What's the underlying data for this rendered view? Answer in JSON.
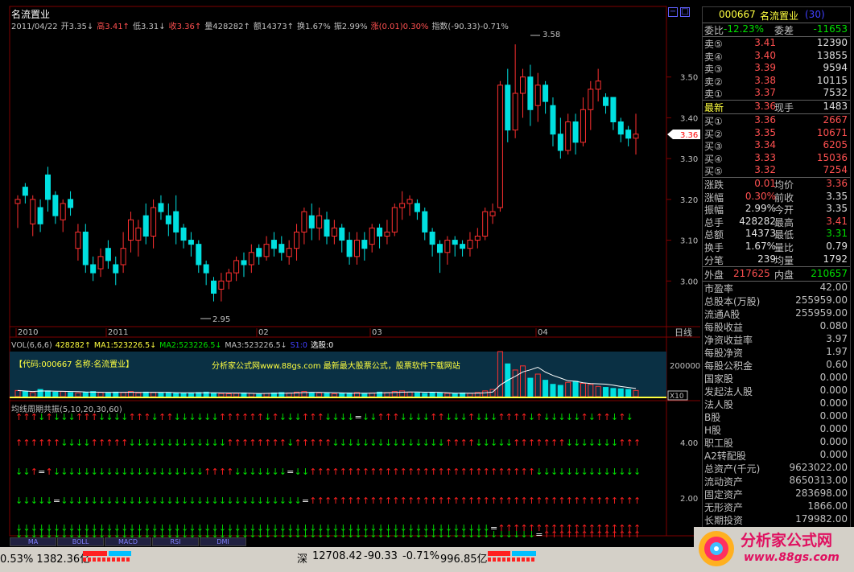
{
  "stock": {
    "name": "名流置业",
    "code": "000667",
    "date": "2011/04/22",
    "rank": "(30)"
  },
  "header_line": [
    {
      "text": "2011/04/22",
      "color": "#c0c0c0"
    },
    {
      "text": "开3.35↓",
      "color": "#c0c0c0"
    },
    {
      "text": "高3.41↑",
      "color": "#ff5050"
    },
    {
      "text": "低3.31↓",
      "color": "#c0c0c0"
    },
    {
      "text": "收3.36↑",
      "color": "#ff5050"
    },
    {
      "text": "量428282↑",
      "color": "#c0c0c0"
    },
    {
      "text": "额14373↑",
      "color": "#c0c0c0"
    },
    {
      "text": "换1.67%",
      "color": "#c0c0c0"
    },
    {
      "text": "振2.99%",
      "color": "#c0c0c0"
    },
    {
      "text": "涨(0.01)0.30%",
      "color": "#ff5050"
    },
    {
      "text": "指数(-90.33)-0.71%",
      "color": "#c0c0c0"
    }
  ],
  "price_axis": {
    "labels": [
      "3.50",
      "3.40",
      "3.30",
      "3.20",
      "3.10",
      "3.00"
    ],
    "current_price": "3.36",
    "high_mark": "3.58",
    "low_mark": "2.95"
  },
  "time_axis": [
    "2010",
    "2011",
    "02",
    "03",
    "04"
  ],
  "period_label": "日线",
  "volume": {
    "legend": [
      {
        "text": "VOL(6,6,6)",
        "color": "#c0c0c0"
      },
      {
        "text": "428282↑",
        "color": "#ffff40"
      },
      {
        "text": "MA1:523226.5↓",
        "color": "#ffff40"
      },
      {
        "text": "MA2:523226.5↓",
        "color": "#00e000"
      },
      {
        "text": "MA3:523226.5↓",
        "color": "#c0c0c0"
      },
      {
        "text": "S1:0",
        "color": "#4040ff"
      },
      {
        "text": "选股:0",
        "color": "#ffffff"
      }
    ],
    "axis_label": "200000",
    "multiplier": "X10",
    "banner_code": "【代码:000667 名称:名流置业】",
    "banner_ad": "分析家公式网www.88gs.com 最新最大股票公式，股票软件下载网站"
  },
  "resonance": {
    "title": "均线周期共振(5,10,20,30,60)",
    "axis_labels": [
      "4.00",
      "2.00"
    ]
  },
  "quote": {
    "ratio_label": "委比",
    "ratio_value": "-12.23%",
    "diff_label": "委差",
    "diff_value": "-11653",
    "sell": [
      {
        "label": "卖⑤",
        "price": "3.41",
        "vol": "12390"
      },
      {
        "label": "卖④",
        "price": "3.40",
        "vol": "13855"
      },
      {
        "label": "卖③",
        "price": "3.39",
        "vol": "9594"
      },
      {
        "label": "卖②",
        "price": "3.38",
        "vol": "10115"
      },
      {
        "label": "卖①",
        "price": "3.37",
        "vol": "7532"
      }
    ],
    "last_label": "最新",
    "last_price": "3.36",
    "hand_label": "现手",
    "hand_value": "1483",
    "buy": [
      {
        "label": "买①",
        "price": "3.36",
        "vol": "2667"
      },
      {
        "label": "买②",
        "price": "3.35",
        "vol": "10671"
      },
      {
        "label": "买③",
        "price": "3.34",
        "vol": "6205"
      },
      {
        "label": "买④",
        "price": "3.33",
        "vol": "15036"
      },
      {
        "label": "买⑤",
        "price": "3.32",
        "vol": "7254"
      }
    ],
    "stats": [
      {
        "l1": "涨跌",
        "v1": "0.01",
        "c1": "red",
        "l2": "均价",
        "v2": "3.36",
        "c2": "red"
      },
      {
        "l1": "涨幅",
        "v1": "0.30%",
        "c1": "red",
        "l2": "前收",
        "v2": "3.35",
        "c2": "white"
      },
      {
        "l1": "振幅",
        "v1": "2.99%",
        "c1": "white",
        "l2": "今开",
        "v2": "3.35",
        "c2": "white"
      },
      {
        "l1": "总手",
        "v1": "428282",
        "c1": "white",
        "l2": "最高",
        "v2": "3.41",
        "c2": "red"
      },
      {
        "l1": "总额",
        "v1": "14373",
        "c1": "white",
        "l2": "最低",
        "v2": "3.31",
        "c2": "green"
      },
      {
        "l1": "换手",
        "v1": "1.67%",
        "c1": "white",
        "l2": "量比",
        "v2": "0.79",
        "c2": "white"
      },
      {
        "l1": "分笔",
        "v1": "239",
        "c1": "white",
        "l2": "均量",
        "v2": "1792",
        "c2": "white"
      }
    ],
    "outer_label": "外盘",
    "outer_value": "217625",
    "inner_label": "内盘",
    "inner_value": "210657"
  },
  "fundamentals": [
    {
      "label": "市盈率",
      "value": "42.00"
    },
    {
      "label": "总股本(万股)",
      "value": "255959.00"
    },
    {
      "label": "流通A股",
      "value": "255959.00"
    },
    {
      "label": "每股收益",
      "value": "0.080"
    },
    {
      "label": "净资收益率",
      "value": "3.97"
    },
    {
      "label": "每股净资",
      "value": "1.97"
    },
    {
      "label": "每股公积金",
      "value": "0.60"
    },
    {
      "label": "国家股",
      "value": "0.000"
    },
    {
      "label": "发起法人股",
      "value": "0.000"
    },
    {
      "label": "法人股",
      "value": "0.000"
    },
    {
      "label": "B股",
      "value": "0.000"
    },
    {
      "label": "H股",
      "value": "0.000"
    },
    {
      "label": "职工股",
      "value": "0.000"
    },
    {
      "label": "A2转配股",
      "value": "0.000"
    },
    {
      "label": "总资产(千元)",
      "value": "9623022.00"
    },
    {
      "label": "流动资产",
      "value": "8650313.00"
    },
    {
      "label": "固定资产",
      "value": "283698.00"
    },
    {
      "label": "无形资产",
      "value": "1866.00"
    },
    {
      "label": "长期投资",
      "value": "179982.00"
    }
  ],
  "tabs": [
    "MA",
    "BOLL",
    "MACD",
    "RSI",
    "DMI"
  ],
  "status_bar": {
    "left_text": "0.53% 1382.36亿",
    "market_label": "深",
    "index_value": "12708.42",
    "index_change": "-90.33",
    "index_pct": "-0.71%",
    "index_amount": "996.85亿"
  },
  "brand": {
    "name": "分析家公式网",
    "url": "www.88gs.com"
  },
  "colors": {
    "up": "#ff3030",
    "down": "#00e0e0",
    "background": "#000000",
    "grid": "#800000"
  },
  "chart_data": {
    "type": "candlestick",
    "title": "",
    "ylim": [
      2.9,
      3.6
    ],
    "candles": [
      [
        3.19,
        3.2,
        3.13,
        3.21
      ],
      [
        3.23,
        3.21,
        3.19,
        3.24
      ],
      [
        3.14,
        3.2,
        3.11,
        3.21
      ],
      [
        3.18,
        3.14,
        3.12,
        3.2
      ],
      [
        3.26,
        3.2,
        3.17,
        3.28
      ],
      [
        3.21,
        3.16,
        3.14,
        3.22
      ],
      [
        3.15,
        3.19,
        3.12,
        3.2
      ],
      [
        3.2,
        3.18,
        3.16,
        3.22
      ],
      [
        3.08,
        3.12,
        3.05,
        3.14
      ],
      [
        3.12,
        3.04,
        3.02,
        3.14
      ],
      [
        3.04,
        3.02,
        3.0,
        3.06
      ],
      [
        3.03,
        3.06,
        3.01,
        3.08
      ],
      [
        3.08,
        3.05,
        3.03,
        3.1
      ],
      [
        3.04,
        3.02,
        2.99,
        3.06
      ],
      [
        3.04,
        3.08,
        3.02,
        3.12
      ],
      [
        3.1,
        3.15,
        3.07,
        3.17
      ],
      [
        3.1,
        3.13,
        3.06,
        3.15
      ],
      [
        3.16,
        3.11,
        3.09,
        3.19
      ],
      [
        3.11,
        3.18,
        3.08,
        3.2
      ],
      [
        3.19,
        3.17,
        3.15,
        3.21
      ],
      [
        3.16,
        3.14,
        3.11,
        3.19
      ],
      [
        3.17,
        3.12,
        3.09,
        3.21
      ],
      [
        3.13,
        3.1,
        3.08,
        3.14
      ],
      [
        3.1,
        3.09,
        3.06,
        3.12
      ],
      [
        3.09,
        3.04,
        3.02,
        3.1
      ],
      [
        3.04,
        3.02,
        2.99,
        3.05
      ],
      [
        3.0,
        2.97,
        2.95,
        3.01
      ],
      [
        2.98,
        3.0,
        2.95,
        3.02
      ],
      [
        3.0,
        3.02,
        2.98,
        3.03
      ],
      [
        3.02,
        3.05,
        3.0,
        3.06
      ],
      [
        3.05,
        3.04,
        3.01,
        3.07
      ],
      [
        3.04,
        3.07,
        3.02,
        3.09
      ],
      [
        3.08,
        3.06,
        3.04,
        3.09
      ],
      [
        3.06,
        3.09,
        3.05,
        3.11
      ],
      [
        3.1,
        3.08,
        3.06,
        3.12
      ],
      [
        3.09,
        3.07,
        3.05,
        3.11
      ],
      [
        3.06,
        3.08,
        3.04,
        3.1
      ],
      [
        3.08,
        3.12,
        3.05,
        3.14
      ],
      [
        3.12,
        3.17,
        3.09,
        3.18
      ],
      [
        3.16,
        3.13,
        3.1,
        3.19
      ],
      [
        3.13,
        3.16,
        3.1,
        3.18
      ],
      [
        3.15,
        3.11,
        3.09,
        3.17
      ],
      [
        3.11,
        3.13,
        3.09,
        3.15
      ],
      [
        3.13,
        3.1,
        3.07,
        3.14
      ],
      [
        3.1,
        3.06,
        3.04,
        3.12
      ],
      [
        3.06,
        3.1,
        3.04,
        3.12
      ],
      [
        3.1,
        3.08,
        3.05,
        3.12
      ],
      [
        3.09,
        3.13,
        3.07,
        3.14
      ],
      [
        3.13,
        3.11,
        3.08,
        3.14
      ],
      [
        3.11,
        3.12,
        3.09,
        3.15
      ],
      [
        3.12,
        3.18,
        3.11,
        3.19
      ],
      [
        3.18,
        3.19,
        3.15,
        3.22
      ],
      [
        3.19,
        3.2,
        3.16,
        3.21
      ],
      [
        3.19,
        3.17,
        3.15,
        3.2
      ],
      [
        3.17,
        3.12,
        3.1,
        3.18
      ],
      [
        3.12,
        3.09,
        3.06,
        3.13
      ],
      [
        3.09,
        3.07,
        3.02,
        3.1
      ],
      [
        3.07,
        3.1,
        3.04,
        3.11
      ],
      [
        3.1,
        3.09,
        3.06,
        3.11
      ],
      [
        3.09,
        3.08,
        3.06,
        3.1
      ],
      [
        3.08,
        3.1,
        3.06,
        3.12
      ],
      [
        3.1,
        3.11,
        3.08,
        3.13
      ],
      [
        3.11,
        3.17,
        3.1,
        3.18
      ],
      [
        3.16,
        3.17,
        3.14,
        3.19
      ],
      [
        3.18,
        3.48,
        3.17,
        3.49
      ],
      [
        3.48,
        3.37,
        3.34,
        3.52
      ],
      [
        3.37,
        3.46,
        3.35,
        3.58
      ],
      [
        3.46,
        3.5,
        3.4,
        3.52
      ],
      [
        3.5,
        3.42,
        3.38,
        3.53
      ],
      [
        3.43,
        3.48,
        3.39,
        3.51
      ],
      [
        3.48,
        3.44,
        3.41,
        3.49
      ],
      [
        3.43,
        3.36,
        3.33,
        3.45
      ],
      [
        3.36,
        3.32,
        3.3,
        3.4
      ],
      [
        3.32,
        3.39,
        3.31,
        3.41
      ],
      [
        3.39,
        3.34,
        3.31,
        3.41
      ],
      [
        3.34,
        3.42,
        3.33,
        3.45
      ],
      [
        3.42,
        3.47,
        3.37,
        3.49
      ],
      [
        3.47,
        3.49,
        3.44,
        3.52
      ],
      [
        3.45,
        3.43,
        3.41,
        3.46
      ],
      [
        3.45,
        3.39,
        3.37,
        3.45
      ],
      [
        3.39,
        3.36,
        3.34,
        3.4
      ],
      [
        3.37,
        3.35,
        3.33,
        3.38
      ],
      [
        3.35,
        3.36,
        3.31,
        3.41
      ]
    ],
    "volume_ylim": [
      0,
      220000
    ],
    "volumes": [
      30,
      25,
      20,
      35,
      28,
      22,
      25,
      20,
      18,
      22,
      25,
      20,
      18,
      22,
      20,
      25,
      18,
      22,
      20,
      18,
      20,
      18,
      16,
      18,
      20,
      22,
      18,
      15,
      14,
      16,
      18,
      16,
      14,
      16,
      18,
      20,
      18,
      22,
      25,
      20,
      18,
      16,
      14,
      16,
      18,
      20,
      16,
      18,
      22,
      20,
      25,
      28,
      22,
      18,
      16,
      20,
      18,
      16,
      14,
      18,
      16,
      20,
      28,
      35,
      220,
      160,
      130,
      150,
      90,
      110,
      80,
      60,
      55,
      70,
      75,
      65,
      60,
      50,
      45,
      40,
      38,
      35,
      30
    ],
    "signals": [
      "↑↑↑↓↑↓↓↓↑↑↑↓↓↓↓↑↑↑↓↑↑↓↓↓↓↓↓↑↑↑↑↑↑↓↑↓↓↓↑↑↑↓↓↓↓=↓↓↑↑↑↓↓↓↓↑↑↓↓↓↑↓↓↓↑↑↑↑↓↑↓↓↓↓↓↑↓↑↑↓↑↓",
      "↑↑↑↑↑↑↓↓↓↓↑↑↑↑↑↓↓↓↓↓↓↓↓↓↓↓↓↓↑↑↑↑↑↑↑↑↓↑↑↑↑↑↓↓↓↓↓↓↓↓↓↓↓↓↓↓↓↑↑↑↑↓↓↓↓↓↑↑↑↑↑↑↑↓↓↓↓↓↓↓↑↑↑↓↓",
      "↓↓↑=↑↓↓↓↓↓↓↓↓↓↓↓↓↓↓↓↓↓↓↓↓↑↑↑↑↓↓↓↓↓↓↓=↓↓↑↑↑↑↑↑↑↑↑↑↑↑↑↑↑↑↑↑↑↑↑↑↑↑↑↑↑↑↑↑↓↓↓↓↓↓↓↓↓↓↓↓↓↓↓↓↓↓",
      "↓↓↓↓↓=↓↓↓↓↓↓↓↓↓↓↓↓↓↓↓↓↓↓↓↓↓↓↓↓↓↓↓↓↓↓↓↓=↑↑↑↑↑↑↑↑↑↑↑↑↑↑↑↑↑↑↑↑↑↑↑↑↑↑↑↑↑↑↑↑↑↑↑↑↑↑↑↑↑↑↑↑↑↑↑↑",
      "↓↓↓↓↓↓↓↓↓↓↓↓↓↓↓↓↓↓↓↓↓↓↓↓↓↓↓↓↓↓↓↓↓↓↓↓↓↓↓↓↓↓↓↓↓↓↓↓↓↓↓↓↓↓↓↓↓↓↓↓↓↓↓=↑↑↑↑↑↑↑↑↑↑↑↑↑↑↑↑↑↑↑↑↑↑↑↑",
      "↓↓↓↓↓↓↓↓↓↓↓↓↓↓↓↓↓↓↓↓↓↓↓↓↓↓↓↓↓↓↓↓↓↓↓↓↓↓↓↓↓↓↓↓↓↓↓↓↓↓↓↓↓↓↓↓↓↓↓↓↓↓↓↓↓↓↓↓↓=↑↑↑↑↑↑↑↑↑↑↑↑↑↑↑↑↑↑↑↑"
    ]
  }
}
